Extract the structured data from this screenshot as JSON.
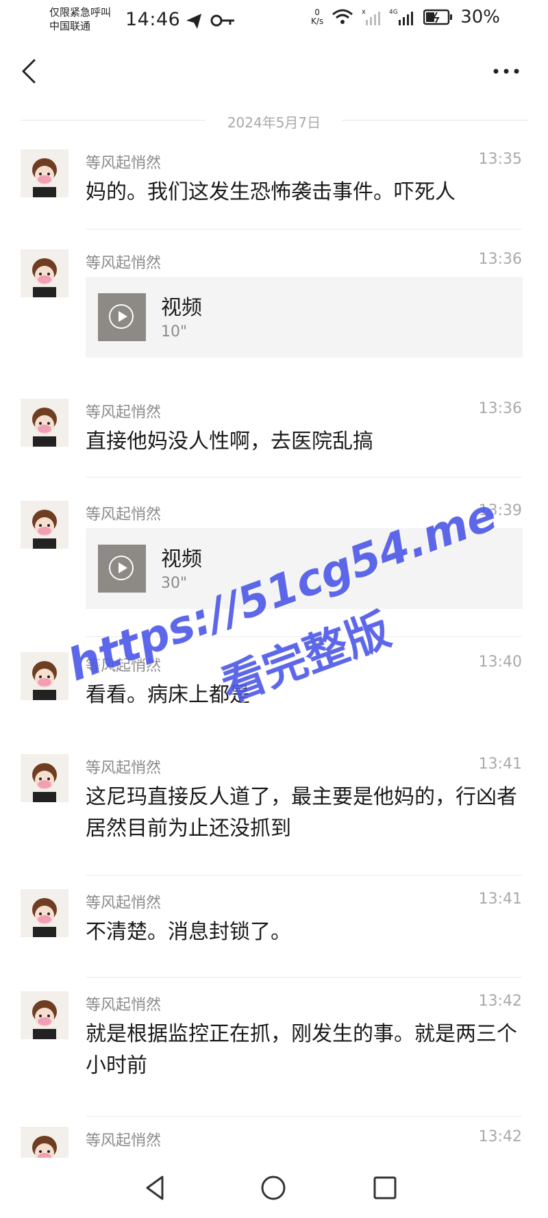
{
  "status_bar": {
    "carrier_line1": "仅限紧急呼叫",
    "carrier_line2": "中国联通",
    "time": "14:46",
    "speed_value": "0",
    "speed_unit": "K/s",
    "network_label": "4G",
    "battery": "30%"
  },
  "chat": {
    "date_separator": "2024年5月7日",
    "messages": [
      {
        "sender": "等风起悄然",
        "time": "13:35",
        "text": "妈的。我们这发生恐怖袭击事件。吓死人"
      },
      {
        "sender": "等风起悄然",
        "time": "13:36",
        "video_title": "视频",
        "video_duration": "10\""
      },
      {
        "sender": "等风起悄然",
        "time": "13:36",
        "text": "直接他妈没人性啊，去医院乱搞"
      },
      {
        "sender": "等风起悄然",
        "time": "13:39",
        "video_title": "视频",
        "video_duration": "30\""
      },
      {
        "sender": "等风起悄然",
        "time": "13:40",
        "text": "看看。病床上都是"
      },
      {
        "sender": "等风起悄然",
        "time": "13:41",
        "text": "这尼玛直接反人道了，最主要是他妈的，行凶者居然目前为止还没抓到"
      },
      {
        "sender": "等风起悄然",
        "time": "13:41",
        "text": "不清楚。消息封锁了。"
      },
      {
        "sender": "等风起悄然",
        "time": "13:42",
        "text": "就是根据监控正在抓，刚发生的事。就是两三个小时前"
      },
      {
        "sender": "等风起悄然",
        "time": "13:42"
      }
    ]
  },
  "watermark": {
    "url": "https://51cg54.me",
    "text": "看完整版",
    "color": "#4a56e8"
  },
  "icons": {
    "back": "chevron-left-icon",
    "more": "more-horizontal-icon",
    "nav_back": "triangle-back-icon",
    "nav_home": "circle-home-icon",
    "nav_recent": "square-recent-icon"
  }
}
